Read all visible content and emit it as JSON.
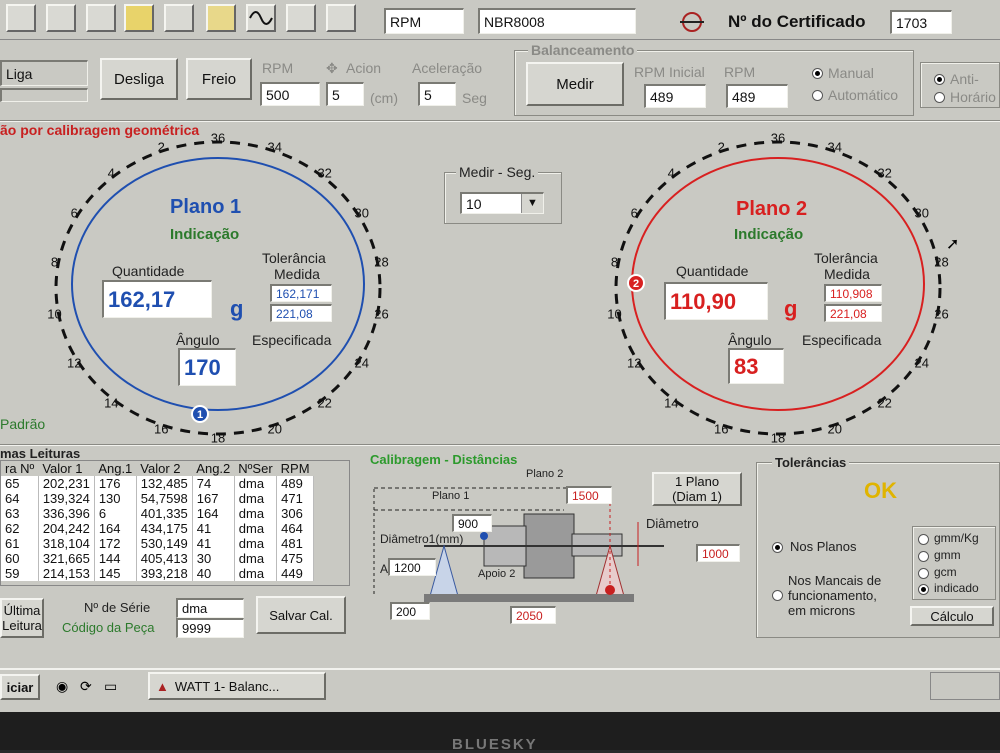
{
  "toolbar": {
    "rpm_label": "RPM",
    "model": "NBR8008",
    "cert_label": "Nº do Certificado",
    "cert_value": "1703"
  },
  "controls": {
    "liga": "Liga",
    "desliga": "Desliga",
    "freio": "Freio",
    "rpm_label": "RPM",
    "rpm_value": "500",
    "acion_label": "Acion",
    "acion_value": "5",
    "acion_unit": "(cm)",
    "accel_label": "Aceleração",
    "accel_value": "5",
    "accel_unit": "Seg"
  },
  "balanceamento": {
    "title": "Balanceamento",
    "medir": "Medir",
    "rpm_inicial_label": "RPM Inicial",
    "rpm_inicial_value": "489",
    "rpm_label": "RPM",
    "rpm_value": "489",
    "manual": "Manual",
    "automatico": "Automático",
    "anti": "Anti-",
    "horario": "Horário"
  },
  "section_title": "ão por calibragem geométrica",
  "medir_seg": {
    "label": "Medir - Seg.",
    "value": "10"
  },
  "plano1": {
    "title": "Plano 1",
    "indicacao": "Indicação",
    "quantidade_label": "Quantidade",
    "quantidade": "162,17",
    "unit": "g",
    "tolerancia_label": "Tolerância",
    "medida_label": "Medida",
    "medida_value": "162,171",
    "especificada_value": "221,08",
    "angulo_label": "Ângulo",
    "especificada_label": "Especificada",
    "angulo": "170",
    "marker": "1",
    "color": "#1f4fb0"
  },
  "plano2": {
    "title": "Plano 2",
    "indicacao": "Indicação",
    "quantidade_label": "Quantidade",
    "quantidade": "110,90",
    "unit": "g",
    "tolerancia_label": "Tolerância",
    "medida_label": "Medida",
    "medida_value": "110,908",
    "especificada_value": "221,08",
    "angulo_label": "Ângulo",
    "especificada_label": "Especificada",
    "angulo": "83",
    "marker": "2",
    "color": "#d82020"
  },
  "dial_ticks": [
    "36",
    "34",
    "32",
    "30",
    "28",
    "26",
    "24",
    "22",
    "20",
    "18",
    "16",
    "14",
    "12",
    "10",
    "8",
    "6",
    "4",
    "2"
  ],
  "padrao": "Padrão",
  "readings": {
    "title": "mas Leituras",
    "headers": [
      "ra Nº",
      "Valor 1",
      "Ang.1",
      "Valor 2",
      "Ang.2",
      "NºSer",
      "RPM"
    ],
    "rows": [
      [
        "65",
        "202,231",
        "176",
        "132,485",
        "74",
        "dma",
        "489"
      ],
      [
        "64",
        "139,324",
        "130",
        "54,7598",
        "167",
        "dma",
        "471"
      ],
      [
        "63",
        "336,396",
        "6",
        "401,335",
        "164",
        "dma",
        "306"
      ],
      [
        "62",
        "204,242",
        "164",
        "434,175",
        "41",
        "dma",
        "464"
      ],
      [
        "61",
        "318,104",
        "172",
        "530,149",
        "41",
        "dma",
        "481"
      ],
      [
        "60",
        "321,665",
        "144",
        "405,413",
        "30",
        "dma",
        "475"
      ],
      [
        "59",
        "214,153",
        "145",
        "393,218",
        "40",
        "dma",
        "449"
      ]
    ],
    "ultima_leitura_1": "Última",
    "ultima_leitura_2": "Leitura",
    "serie_label": "Nº de Série",
    "serie_value": "dma",
    "codigo_label": "Código da Peça",
    "codigo_value": "9999",
    "salvar": "Salvar Cal."
  },
  "calibragem": {
    "title": "Calibragem - Distâncias",
    "plano2_label": "Plano 2",
    "plano1_label": "Plano 1",
    "diametro1_label": "Diâmetro1(mm)",
    "apoio1_label": "A",
    "apoio2_label": "Apoio 2",
    "diametro_label": "Diâmetro",
    "v1500": "1500",
    "v900": "900",
    "v1200": "1200",
    "v1000": "1000",
    "v200": "200",
    "v2050": "2050",
    "um_plano": "1 Plano",
    "diam1": "(Diam 1)"
  },
  "tolerancias": {
    "title": "Tolerâncias",
    "status": "OK",
    "nos_planos": "Nos Planos",
    "nos_mancais_1": "Nos Mancais de",
    "nos_mancais_2": "funcionamento,",
    "nos_mancais_3": "em microns",
    "opt1": "gmm/Kg",
    "opt2": "gmm",
    "opt3": "gcm",
    "opt4": "indicado",
    "calculo": "Cálculo"
  },
  "taskbar": {
    "start": "iciar",
    "task": "WATT 1- Balanc..."
  },
  "monitor_brand": "BLUESKY"
}
